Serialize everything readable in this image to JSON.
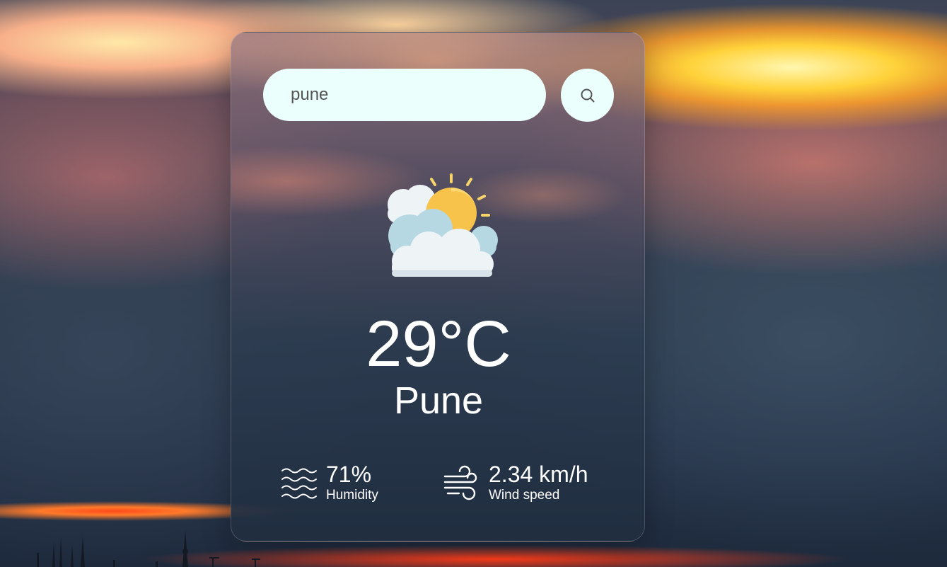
{
  "search": {
    "value": "pune",
    "placeholder": "",
    "button_icon": "search-icon"
  },
  "weather": {
    "icon": "partly-cloudy-icon",
    "temperature": "29°C",
    "city": "Pune"
  },
  "details": {
    "humidity": {
      "icon": "humidity-waves-icon",
      "value": "71%",
      "label": "Humidity"
    },
    "wind": {
      "icon": "wind-icon",
      "value": "2.34 km/h",
      "label": "Wind speed"
    }
  },
  "colors": {
    "input_background": "#ebfffc",
    "text": "#ffffff",
    "sun": "#f7c34a"
  }
}
